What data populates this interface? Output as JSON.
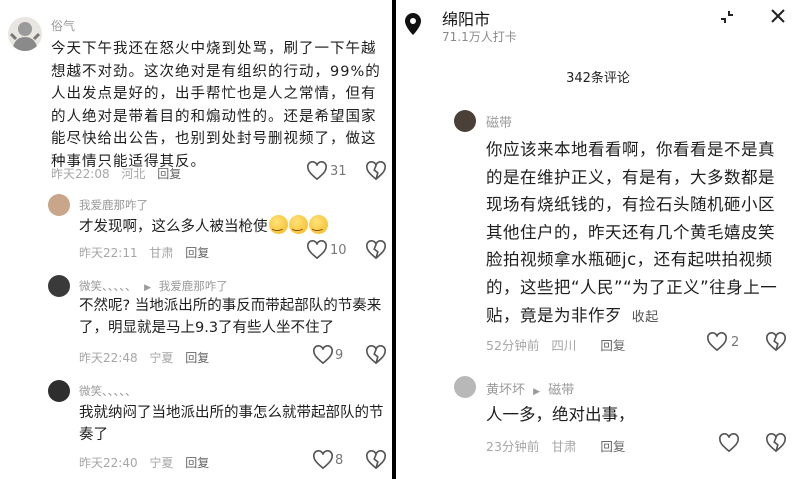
{
  "left": {
    "main": {
      "username": "俗气",
      "text": "今天下午我还在怒火中烧到处骂，刷了一下午越想越不对劲。这次绝对是有组织的行动，99%的人出发点是好的，出手帮忙也是人之常情，但有的人绝对是带着目的和煽动性的。还是希望国家能尽快给出公告，也别到处封号删视频了，做这种事情只能适得其反。",
      "time": "昨天22:08",
      "location": "河北",
      "reply_label": "回复",
      "likes": "31"
    },
    "replies": [
      {
        "username": "我爱鹿那咋了",
        "reply_to": "",
        "text": "才发现啊，这么多人被当枪使",
        "time": "昨天22:11",
        "location": "甘肃",
        "reply_label": "回复",
        "likes": "10"
      },
      {
        "username": "微笑、、、、、",
        "reply_to": "我爱鹿那咋了",
        "text": "不然呢? 当地派出所的事反而带起部队的节奏来了，明显就是马上9.3了有些人坐不住了",
        "time": "昨天22:48",
        "location": "宁夏",
        "reply_label": "回复",
        "likes": "9"
      },
      {
        "username": "微笑、、、、、",
        "reply_to": "",
        "text": "我就纳闷了当地派出所的事怎么就带起部队的节奏了",
        "time": "昨天22:40",
        "location": "宁夏",
        "reply_label": "回复",
        "likes": "8"
      }
    ]
  },
  "right": {
    "location_title": "绵阳市",
    "checkins": "71.1万人打卡",
    "comment_count": "342条评论",
    "comments": [
      {
        "username": "磁带",
        "reply_to": "",
        "text": "你应该来本地看看啊，你看看是不是真的是在维护正义，有是有，大多数都是现场有烧纸钱的，有捡石头随机砸小区其他住户的，昨天还有几个黄毛嬉皮笑脸拍视频拿水瓶砸jc，还有起哄拍视频的，这些把“人民”“为了正义”往身上一贴，竟是为非作歹",
        "collapse_label": "收起",
        "time": "52分钟前",
        "location": "四川",
        "reply_label": "回复",
        "likes": "2"
      },
      {
        "username": "黄坏坏",
        "reply_to": "磁带",
        "text": "人一多，绝对出事，",
        "time": "23分钟前",
        "location": "甘肃",
        "reply_label": "回复",
        "likes": ""
      }
    ]
  },
  "icons": {
    "heart": "heart-icon",
    "dislike": "dislike-heart-icon",
    "pin": "location-pin-icon",
    "collapse": "minimize-icon",
    "close": "close-icon"
  },
  "colors": {
    "text": "#1e1e1e",
    "meta": "#a6a6a6",
    "username": "#9a9a9a"
  }
}
